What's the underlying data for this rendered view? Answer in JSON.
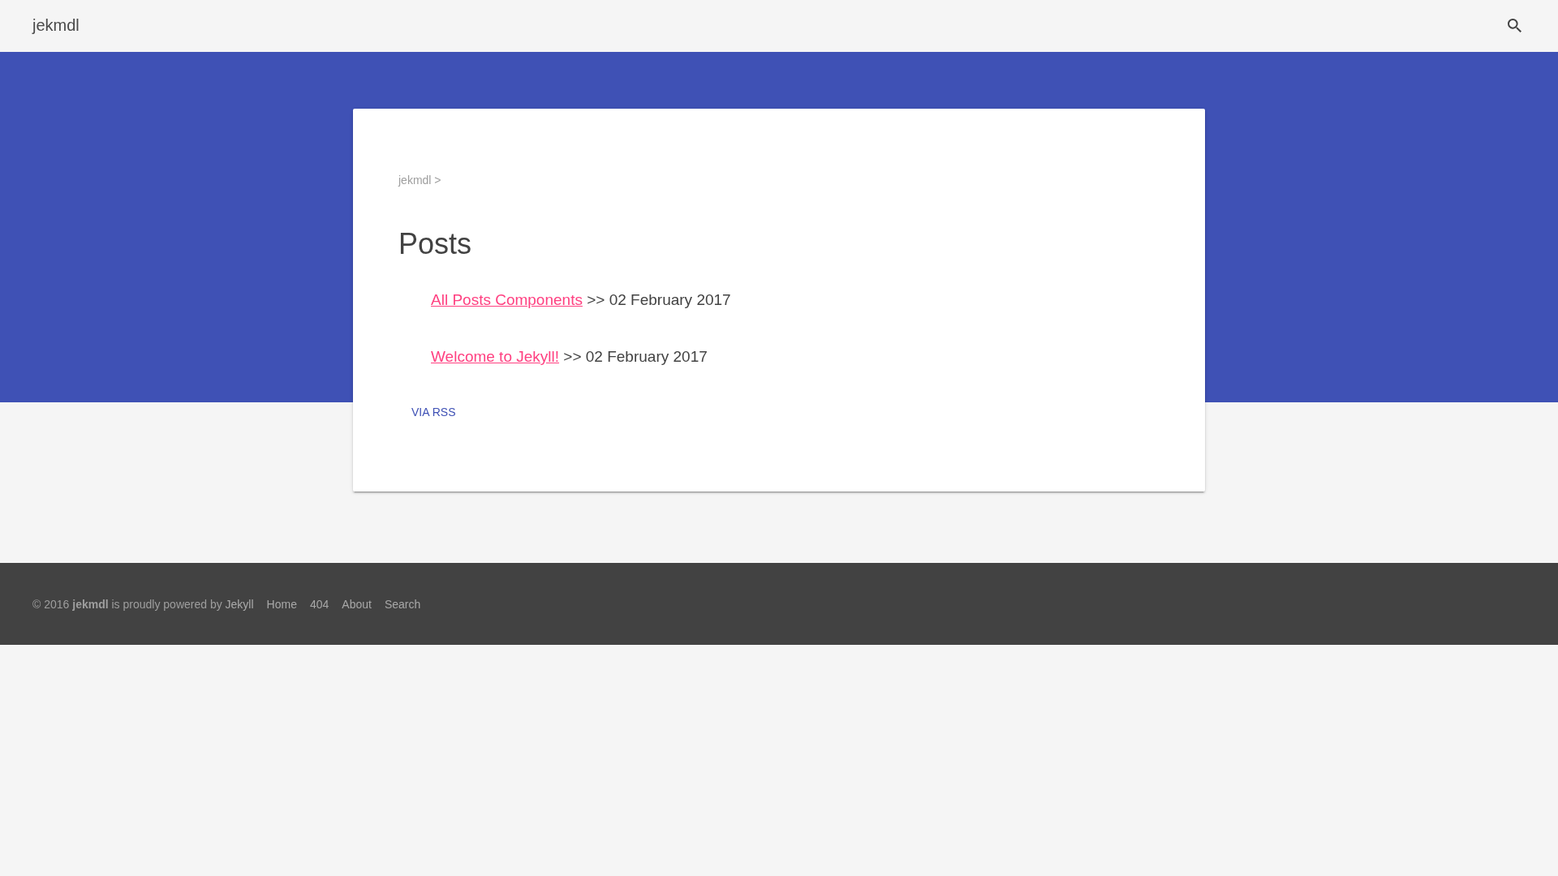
{
  "header": {
    "title": "jekmdl"
  },
  "breadcrumb": "jekmdl >",
  "page_title": "Posts",
  "posts": [
    {
      "title": "All Posts Components",
      "date": ">> 02 February 2017"
    },
    {
      "title": "Welcome to Jekyll!",
      "date": ">> 02 February 2017"
    }
  ],
  "rss_button": "VIA RSS",
  "footer": {
    "credit": "© 2016 **jekmdl** is proudly powered by",
    "credit_link": "Jekyll",
    "links": [
      "Home",
      "404",
      "About",
      "Search"
    ]
  }
}
